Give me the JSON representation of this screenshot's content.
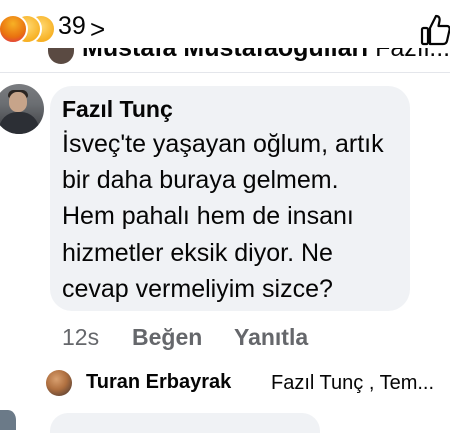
{
  "reactions": {
    "icons": [
      "angry-icon",
      "haha-icon",
      "sad-icon"
    ],
    "count": "39",
    "chevron": ">",
    "like_icon": "thumbs-up-icon"
  },
  "previous_reply": {
    "author": "Mustafa Mustafaoğulları",
    "tag": "Fazıl..."
  },
  "comment": {
    "author": "Fazıl Tunç",
    "text": "İsveç'te yaşayan oğlum, artık\nbir daha buraya gelmem.\nHem pahalı hem de insanı\nhizmetler eksik diyor. Ne\ncevap vermeliyim sizce?",
    "time": "12s",
    "like_label": "Beğen",
    "reply_label": "Yanıtla"
  },
  "reply_preview": {
    "author": "Turan Erbayrak",
    "tag": "Fazıl Tunç , Tem..."
  },
  "colors": {
    "bubble": "#f0f2f5",
    "secondary_text": "#65676b",
    "text": "#050505"
  }
}
